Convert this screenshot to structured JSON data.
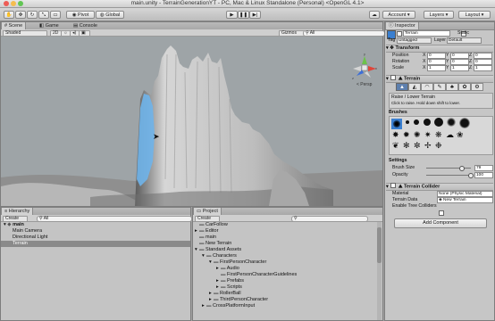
{
  "window": {
    "title": "main.unity - TerrainGenerationYT - PC, Mac & Linux Standalone (Personal) <OpenGL 4.1>"
  },
  "toolbar": {
    "pivot": "Pivot",
    "global": "Global",
    "account": "Account",
    "layers": "Layers",
    "layout": "Layout"
  },
  "scene": {
    "tab_scene": "Scene",
    "tab_game": "Game",
    "tab_console": "Console",
    "shading": "Shaded",
    "mode_2d": "2D",
    "gizmos": "Gizmos",
    "search_placeholder": "All",
    "persp_label": "< Persp",
    "axis_y": "y",
    "axis_x": "x",
    "axis_z": "z"
  },
  "hierarchy": {
    "tab": "Hierarchy",
    "create": "Create",
    "search_placeholder": "All",
    "items": [
      {
        "label": "main",
        "indent": 0,
        "selected": false
      },
      {
        "label": "Main Camera",
        "indent": 1,
        "selected": false
      },
      {
        "label": "Directional Light",
        "indent": 1,
        "selected": false
      },
      {
        "label": "Terrain",
        "indent": 1,
        "selected": true
      }
    ]
  },
  "project": {
    "tab": "Project",
    "create": "Create",
    "items": [
      {
        "label": "CarFollow",
        "indent": 0,
        "arrow": ""
      },
      {
        "label": "Editor",
        "indent": 0,
        "arrow": "▸"
      },
      {
        "label": "main",
        "indent": 0,
        "arrow": ""
      },
      {
        "label": "New Terrain",
        "indent": 0,
        "arrow": ""
      },
      {
        "label": "Standard Assets",
        "indent": 0,
        "arrow": "▾"
      },
      {
        "label": "Characters",
        "indent": 1,
        "arrow": "▾"
      },
      {
        "label": "FirstPersonCharacter",
        "indent": 2,
        "arrow": "▾"
      },
      {
        "label": "Audio",
        "indent": 3,
        "arrow": "▸"
      },
      {
        "label": "FirstPersonCharacterGuidelines",
        "indent": 3,
        "arrow": ""
      },
      {
        "label": "Prefabs",
        "indent": 3,
        "arrow": "▸"
      },
      {
        "label": "Scripts",
        "indent": 3,
        "arrow": "▸"
      },
      {
        "label": "RollerBall",
        "indent": 2,
        "arrow": "▸"
      },
      {
        "label": "ThirdPersonCharacter",
        "indent": 2,
        "arrow": "▸"
      },
      {
        "label": "CrossPlatformInput",
        "indent": 1,
        "arrow": "▸"
      }
    ]
  },
  "inspector": {
    "tab": "Inspector",
    "object_name": "Terrain",
    "static_label": "Static",
    "tag_label": "Tag",
    "tag_value": "Untagged",
    "layer_label": "Layer",
    "layer_value": "Default",
    "transform": {
      "header": "Transform",
      "rows": [
        {
          "label": "Position",
          "x": "0",
          "y": "0",
          "z": "0"
        },
        {
          "label": "Rotation",
          "x": "0",
          "y": "0",
          "z": "0"
        },
        {
          "label": "Scale",
          "x": "1",
          "y": "1",
          "z": "1"
        }
      ]
    },
    "terrain": {
      "header": "Terrain",
      "tool_title": "Raise / Lower Terrain",
      "tool_hint": "Click to raise. Hold down shift to lower.",
      "brushes_label": "Brushes",
      "settings_label": "Settings",
      "brush_size_label": "Brush Size",
      "brush_size_value": "79",
      "brush_size_fraction": 0.79,
      "opacity_label": "Opacity",
      "opacity_value": "100",
      "opacity_fraction": 1.0
    },
    "collider": {
      "header": "Terrain Collider",
      "material_label": "Material",
      "material_value": "None (Physic Material)",
      "data_label": "Terrain Data",
      "data_value": "New Terrain",
      "trees_label": "Enable Tree Colliders"
    },
    "add_component": "Add Component"
  },
  "colors": {
    "accent_blue": "#3a7fd0",
    "terrain_highlight": "#6fb4ea",
    "sky": "#9da3a6"
  }
}
